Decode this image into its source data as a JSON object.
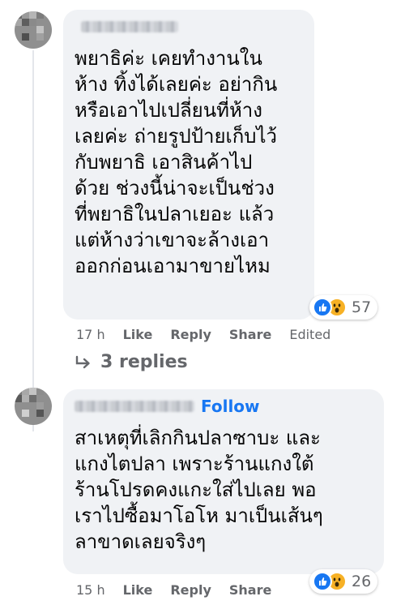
{
  "comments": [
    {
      "text": "พยาธิค่ะ เคยทำงานใน\nห้าง ทิ้งได้เลยค่ะ อย่ากิน\nหรือเอาไปเปลี่ยนที่ห้าง\nเลยค่ะ ถ่ายรูปป้ายเก็บไว้\nกับพยาธิ เอาสินค้าไป\nด้วย ช่วงนี้น่าจะเป็นช่วง\nที่พยาธิในปลาเยอะ แล้ว\nแต่ห้างว่าเขาจะล้างเอา\nออกก่อนเอามาขายไหม",
      "reaction_count": "57",
      "time": "17 h",
      "like": "Like",
      "reply": "Reply",
      "share": "Share",
      "edited": "Edited"
    },
    {
      "follow": "Follow",
      "text": "สาเหตุที่เลิกกินปลาซาบะ และ\nแกงไตปลา เพราะร้านแกงใต้\nร้านโปรดคงแกะใส่ไปเลย พอ\nเราไปซื้อมาโอโห มาเป็นเส้นๆ\nลาขาดเลยจริงๆ",
      "reaction_count": "26",
      "time": "15 h",
      "like": "Like",
      "reply": "Reply",
      "share": "Share"
    }
  ],
  "view_replies": "3 replies",
  "icons": [
    "like-icon",
    "wow-icon",
    "reply-arrow-icon"
  ],
  "colors": {
    "bubble": "#f0f2f5",
    "meta": "#65676b",
    "follow": "#1877f2",
    "like": "#1877f2",
    "wow": "#f7b125"
  }
}
